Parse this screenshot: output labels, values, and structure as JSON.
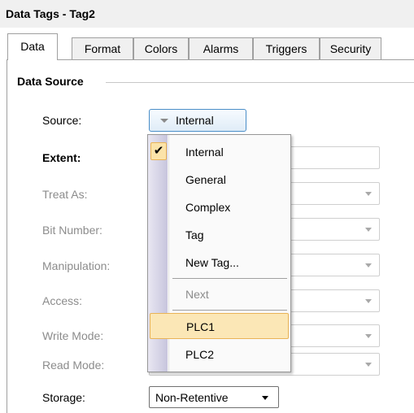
{
  "window": {
    "title": "Data Tags - Tag2"
  },
  "tabs": [
    {
      "label": "Data",
      "active": true
    },
    {
      "label": "Format"
    },
    {
      "label": "Colors"
    },
    {
      "label": "Alarms"
    },
    {
      "label": "Triggers"
    },
    {
      "label": "Security"
    }
  ],
  "group": {
    "title": "Data Source"
  },
  "fields": {
    "source": {
      "label": "Source:",
      "value": "Internal"
    },
    "extent": {
      "label": "Extent:"
    },
    "treat_as": {
      "label": "Treat As:"
    },
    "bit_number": {
      "label": "Bit Number:"
    },
    "manipulation": {
      "label": "Manipulation:"
    },
    "access": {
      "label": "Access:"
    },
    "write_mode": {
      "label": "Write Mode:"
    },
    "read_mode": {
      "label": "Read Mode:"
    },
    "storage": {
      "label": "Storage:",
      "value": "Non-Retentive"
    }
  },
  "source_menu": {
    "items": [
      {
        "label": "Internal",
        "checked": true
      },
      {
        "label": "General"
      },
      {
        "label": "Complex"
      },
      {
        "label": "Tag"
      },
      {
        "label": "New Tag..."
      },
      {
        "label": "Next",
        "disabled": true
      },
      {
        "label": "PLC1",
        "highlighted": true
      },
      {
        "label": "PLC2"
      }
    ],
    "check_glyph": "✔"
  },
  "colors": {
    "accent": "#4a8ec8",
    "highlight_bg": "#fbe7b6",
    "highlight_border": "#e9b356"
  }
}
